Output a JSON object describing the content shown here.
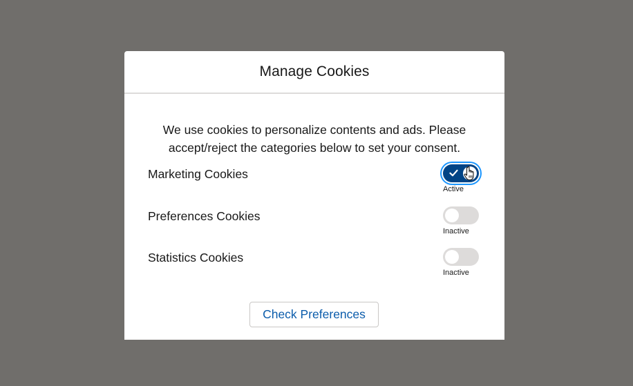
{
  "modal": {
    "title": "Manage Cookies",
    "intro_line1": "We use cookies to personalize contents and ads. Please",
    "intro_line2": "accept/reject the categories below to set your consent.",
    "categories": [
      {
        "label": "Marketing Cookies",
        "state_label": "Active",
        "enabled": true
      },
      {
        "label": "Preferences Cookies",
        "state_label": "Inactive",
        "enabled": false
      },
      {
        "label": "Statistics Cookies",
        "state_label": "Inactive",
        "enabled": false
      }
    ],
    "button_label": "Check Preferences"
  },
  "colors": {
    "overlay": "#706e6b",
    "toggle_on": "#014486",
    "toggle_off": "#dddbda",
    "focus_ring": "#1b96ff",
    "button_text": "#0b5cab"
  },
  "icons": {
    "toggle_on": "check-icon",
    "cursor": "hand-pointer-icon"
  }
}
